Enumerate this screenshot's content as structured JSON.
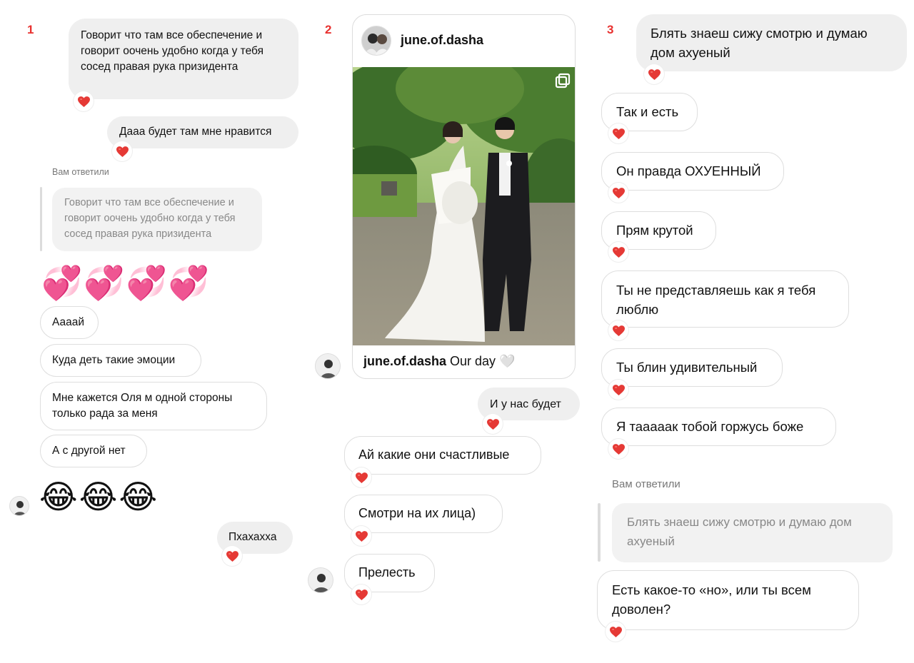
{
  "col1": {
    "number": "1",
    "msg1": "Говорит что там все обеспечение и\nговорит оочень удобно когда у тебя\nсосед правая рука призидента",
    "msg2": "Дааа будет там мне нравится",
    "replied_label": "Вам ответили",
    "quote": "Говорит что там все обеспечение и\nговорит оочень удобно когда у тебя\nсосед правая рука призидента",
    "hearts_emoji": "💞💞💞💞",
    "in1": "Аааай",
    "in2": "Куда деть такие эмоции",
    "in3": "Мне кажется Оля м одной стороны\nтолько рада за меня",
    "in4": "А с другой нет",
    "laugh_emoji": "😂😂😂",
    "out3": "Пхахахха"
  },
  "col2": {
    "number": "2",
    "post_username": "june.of.dasha",
    "caption_username": "june.of.dasha",
    "caption_text": "Our day 🤍",
    "out1": "И у нас будет",
    "in1": "Ай какие они счастливые",
    "in2": "Смотри на их лица)",
    "in3": "Прелесть"
  },
  "col3": {
    "number": "3",
    "out1": "Блять знаеш сижу смотрю и думаю\nдом ахуеный",
    "in1": "Так и есть",
    "in2": "Он правда ОХУЕННЫЙ",
    "in3": "Прям крутой",
    "in4": "Ты не представляешь как я тебя\nлюблю",
    "in5": "Ты блин удивительный",
    "in6": "Я таааaак тобой горжусь боже",
    "replied_label": "Вам ответили",
    "quote": "Блять знаеш сижу смотрю и думаю дом\nахуеный",
    "in7": "Есть какое-то «но», или ты всем\nдоволен?"
  },
  "colors": {
    "accent_red": "#e8312f",
    "heart": "#e53935",
    "outgoing_bg": "#efefef"
  },
  "icons": {
    "reaction": "heart-icon",
    "multi": "carousel-icon"
  }
}
